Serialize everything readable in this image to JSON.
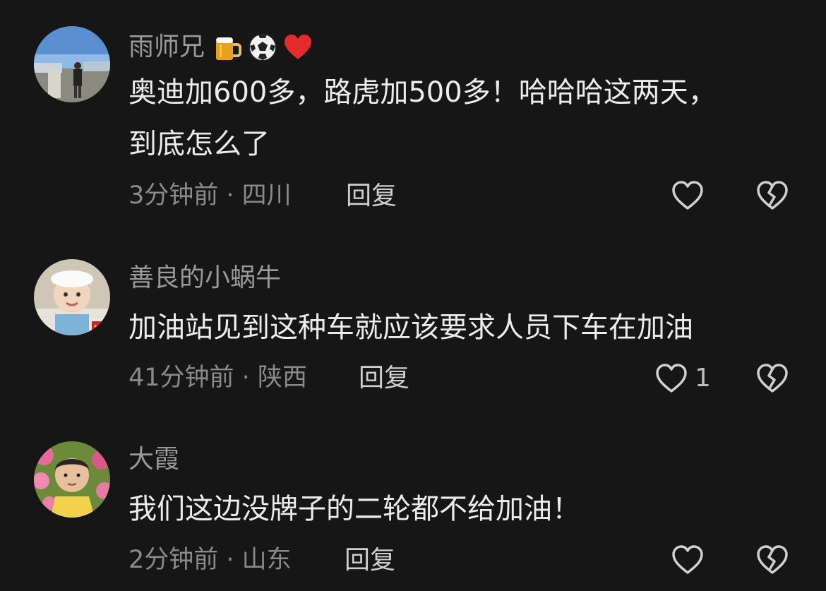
{
  "comments": [
    {
      "username": "雨师兄",
      "badges": [
        "beer-icon",
        "soccer-ball-icon",
        "red-heart-icon"
      ],
      "text": "奥迪加600多，路虎加500多！哈哈哈这两天，\n到底怎么了",
      "time": "3分钟前",
      "location": "四川",
      "reply_label": "回复",
      "like_count": ""
    },
    {
      "username": "善良的小蜗牛",
      "badges": [],
      "text": "加油站见到这种车就应该要求人员下车在加油",
      "time": "41分钟前",
      "location": "陕西",
      "reply_label": "回复",
      "like_count": "1"
    },
    {
      "username": "大霞",
      "badges": [],
      "text": "我们这边没牌子的二轮都不给加油！",
      "time": "2分钟前",
      "location": "山东",
      "reply_label": "回复",
      "like_count": ""
    }
  ],
  "meta_separator": " · ",
  "colors": {
    "background": "#161616",
    "username": "#9a9a9a",
    "text": "#ececec",
    "meta": "#8a8a8a",
    "icon": "#d0d0d0"
  }
}
